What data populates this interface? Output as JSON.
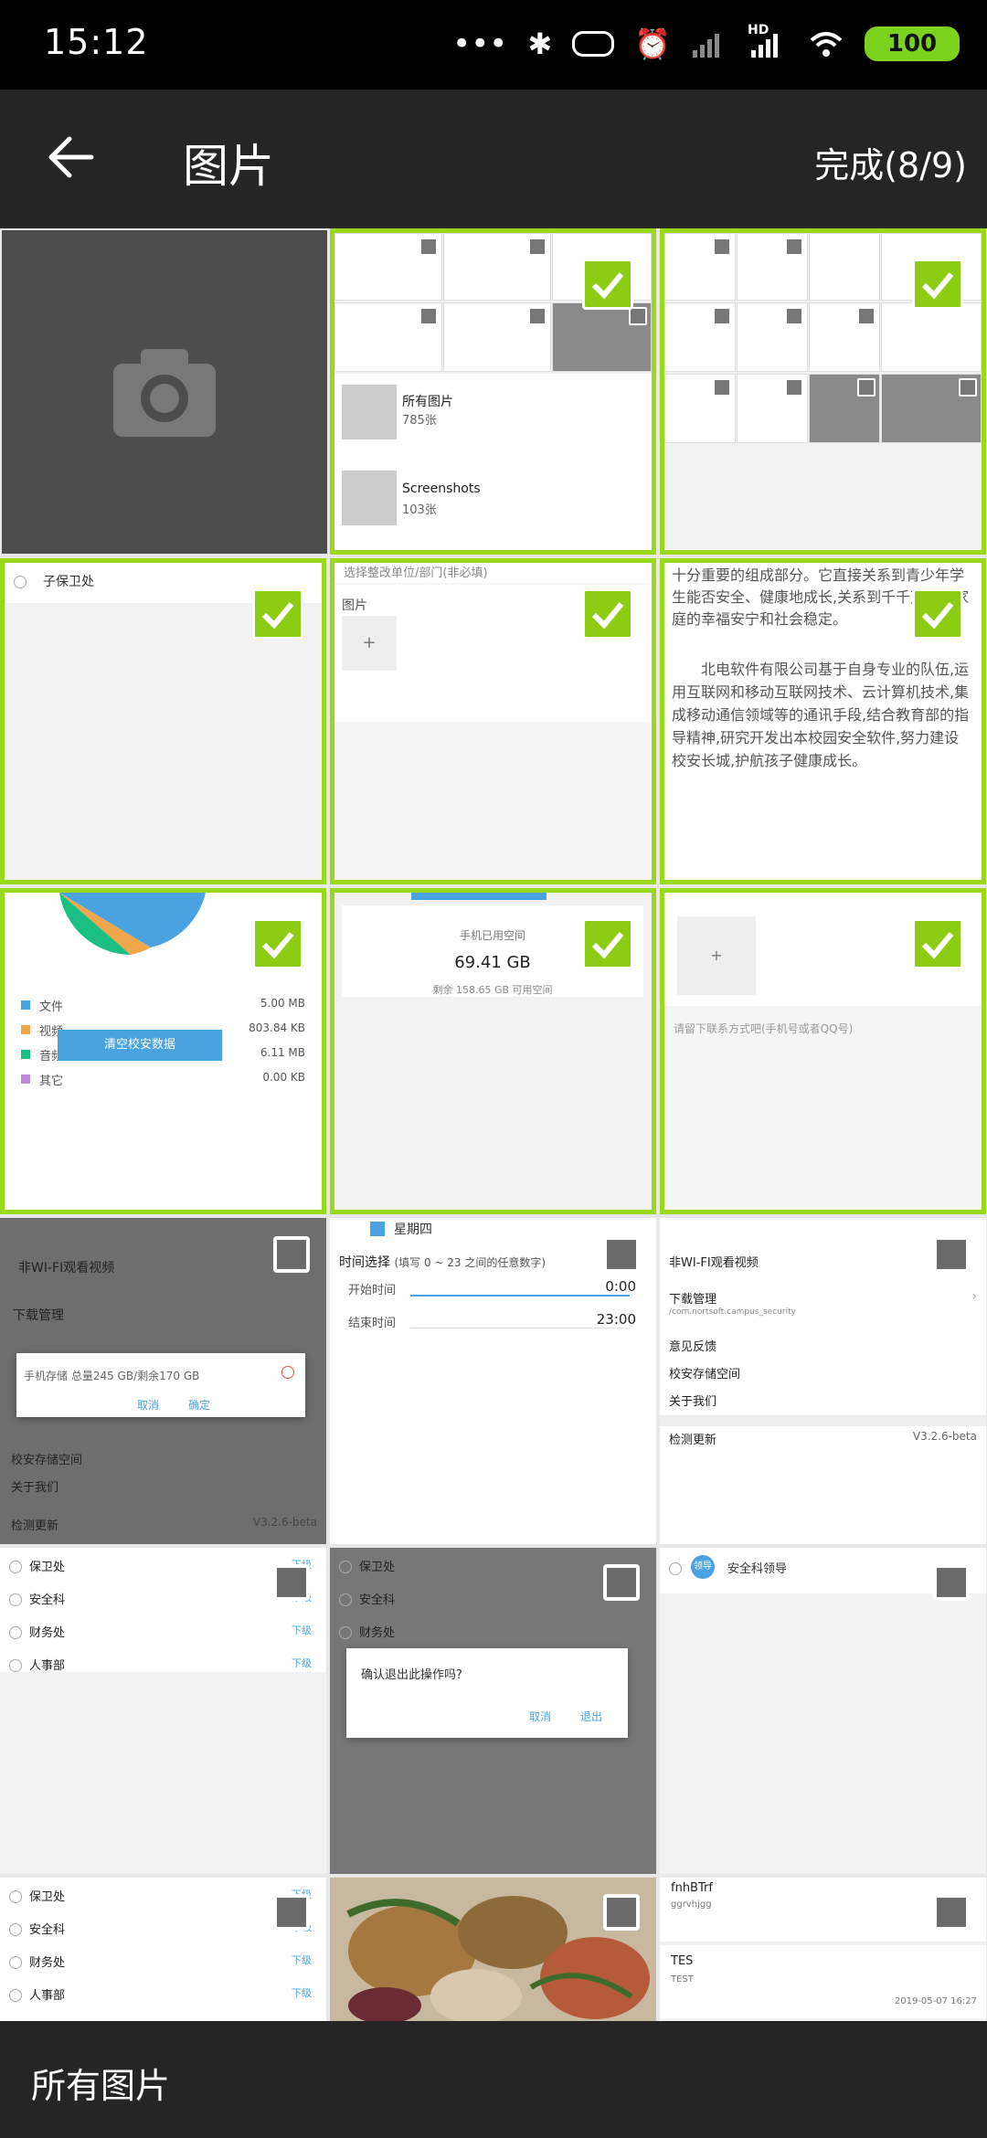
{
  "status": {
    "time": "15:12",
    "battery": "100",
    "hd_label": "HD"
  },
  "appbar": {
    "title": "图片",
    "done": "完成(8/9)"
  },
  "bottom": {
    "album_name": "所有图片"
  },
  "thumb2": {
    "albums": [
      {
        "name": "所有图片",
        "count": "785张"
      },
      {
        "name": "Screenshots",
        "count": "103张"
      }
    ]
  },
  "thumb4": {
    "radio_label": "子保卫处"
  },
  "thumb5": {
    "select_hint": "选择整改单位/部门(非必填)",
    "image_label": "图片",
    "add": "+"
  },
  "thumb6": {
    "para1": "十分重要的组成部分。它直接关系到青少年学生能否安全、健康地成长,关系到千千万万个家庭的幸福安宁和社会稳定。",
    "para2": "北电软件有限公司基于自身专业的队伍,运用互联网和移动互联网技术、云计算机技术,集成移动通信领域等的通讯手段,结合教育部的指导精神,研究开发出本校园安全软件,努力建设校安长城,护航孩子健康成长。"
  },
  "thumb7": {
    "legend": [
      {
        "name": "文件",
        "value": "5.00 MB",
        "color": "#4aa3e0"
      },
      {
        "name": "视频",
        "value": "803.84 KB",
        "color": "#f0a64a"
      },
      {
        "name": "音频",
        "value": "6.11 MB",
        "color": "#1bbf83"
      },
      {
        "name": "其它",
        "value": "0.00 KB",
        "color": "#b98adb"
      }
    ],
    "clear_button": "清空校安数据"
  },
  "thumb8": {
    "label": "手机已用空间",
    "used": "69.41 GB",
    "remaining": "剩余 158.65 GB 可用空间"
  },
  "thumb9": {
    "add": "+",
    "contact_hint": "请留下联系方式吧(手机号或者QQ号)"
  },
  "thumb10": {
    "wifi": "非WI-FI观看视频",
    "download": "下载管理",
    "storage_line": "手机存储  总量245 GB/剩余170 GB",
    "cancel": "取消",
    "ok": "确定",
    "space": "校安存储空间",
    "about": "关于我们",
    "update": "检测更新",
    "version": "V3.2.6-beta"
  },
  "thumb11": {
    "weekday": "星期四",
    "time_title": "时间选择",
    "time_hint": "(填写 0 ~ 23 之间的任意数字)",
    "start_label": "开始时间",
    "start_value": "0:00",
    "end_label": "结束时间",
    "end_value": "23:00"
  },
  "thumb12": {
    "wifi": "非WI-FI观看视频",
    "download": "下载管理",
    "path": "/com.nortsoft.campus_security",
    "feedback": "意见反馈",
    "space": "校安存储空间",
    "about": "关于我们",
    "update": "检测更新",
    "version": "V3.2.6-beta"
  },
  "thumb13": {
    "items": [
      "保卫处",
      "安全科",
      "财务处",
      "人事部"
    ],
    "sub": "下级"
  },
  "thumb14": {
    "items": [
      "保卫处",
      "安全科",
      "财务处"
    ],
    "confirm": "确认退出此操作吗?",
    "cancel": "取消",
    "exit": "退出"
  },
  "thumb15": {
    "badge": "领导",
    "label": "安全科领导"
  },
  "thumb16": {
    "items": [
      "保卫处",
      "安全科",
      "财务处",
      "人事部"
    ],
    "sub": "下级"
  },
  "thumb18": {
    "title1": "fnhBTrf",
    "sub1": "ggrvhjgg",
    "title2": "TES",
    "sub2": "TEST",
    "date": "2019-05-07 16:27"
  }
}
